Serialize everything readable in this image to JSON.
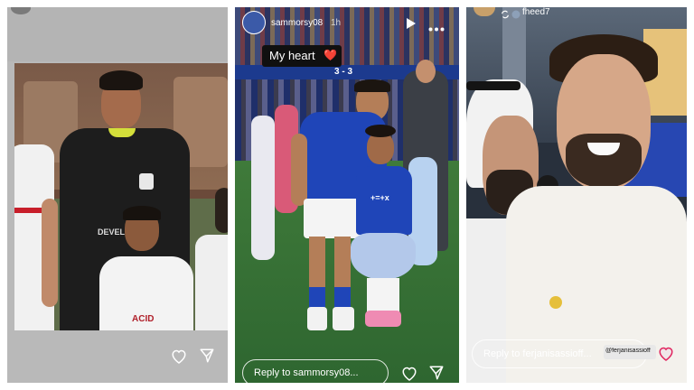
{
  "stories": [
    {
      "id_label": "",
      "reply_placeholder": "",
      "icons": [
        "avatar",
        "heart-icon",
        "send-icon"
      ],
      "jersey_text": "DEVEL",
      "shirt_text": "ACID"
    },
    {
      "username": "sammorsy08",
      "time_ago": "1h",
      "caption": "My heart",
      "caption_emoji": "❤️",
      "reply_placeholder": "Reply to sammorsy08...",
      "banner_text": "3 - 3",
      "shirt_text": "+=+x",
      "icons": [
        "avatar",
        "play-icon",
        "more-icon",
        "heart-icon",
        "send-icon"
      ]
    },
    {
      "username": "fheed7",
      "reply_placeholder": "Reply to ferjanisassioff...",
      "mention_tag": "@ferjanisassioff",
      "icons": [
        "avatar",
        "repost-icon",
        "heart-icon"
      ]
    }
  ],
  "colors": {
    "ipswich_blue": "#1f45b8",
    "zamalek_white": "#f1f1f1",
    "keeper_black": "#1d1d1d",
    "heart_red": "#e0245e"
  }
}
